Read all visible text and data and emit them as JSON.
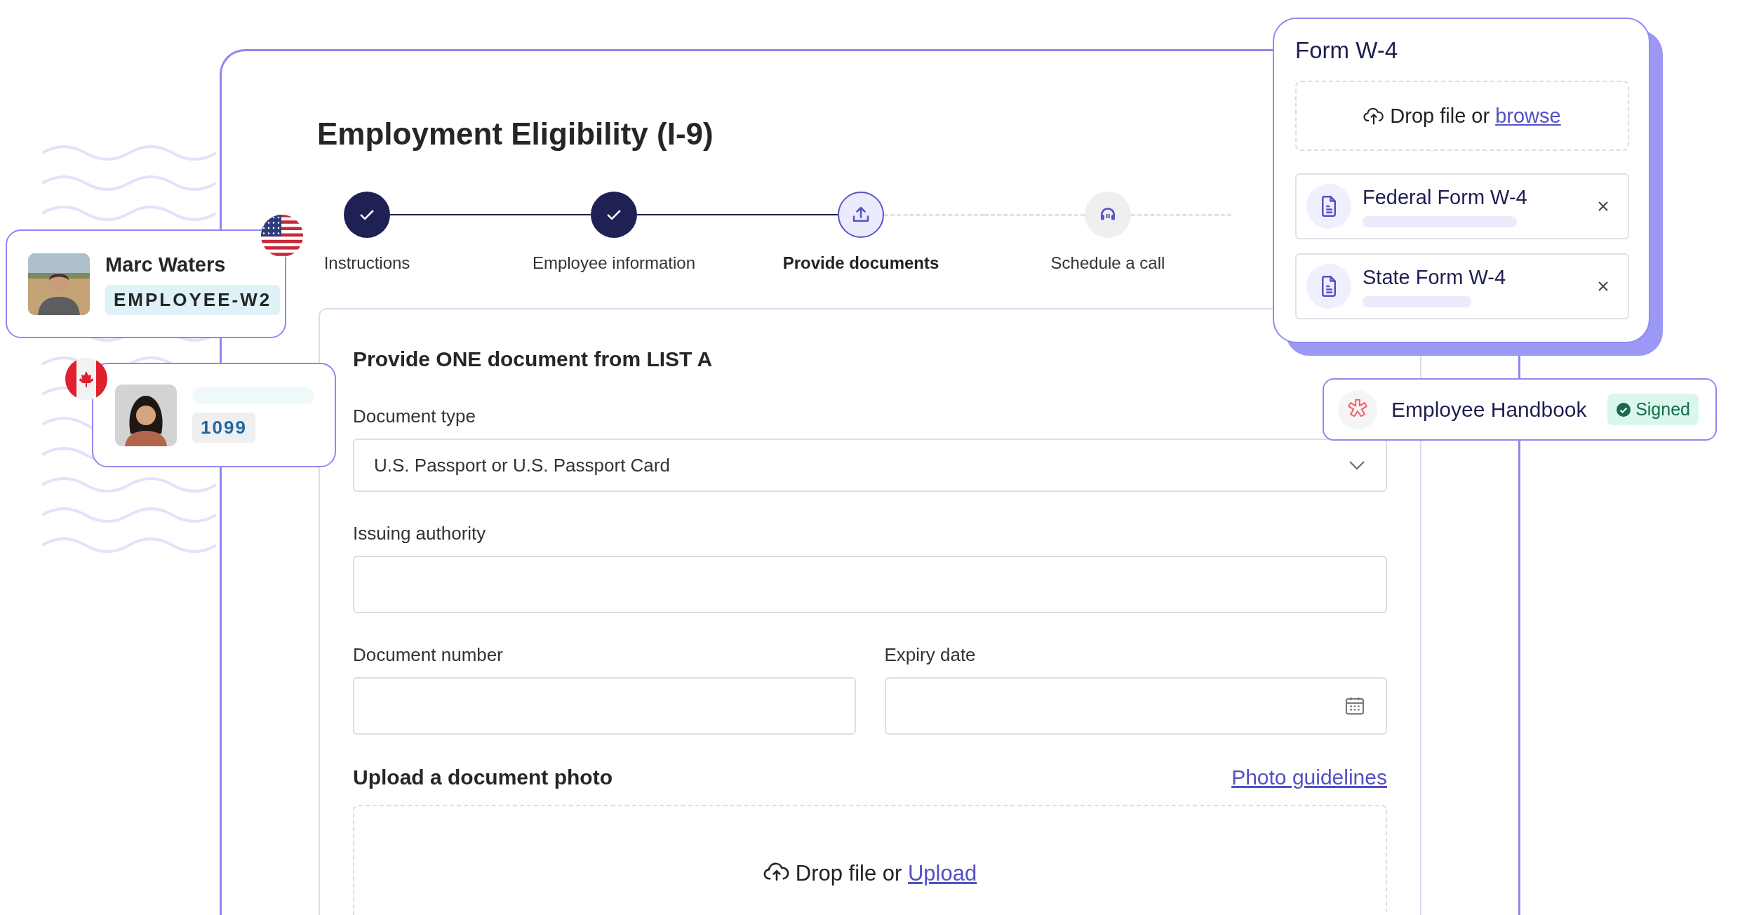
{
  "title": "Employment Eligibility (I-9)",
  "steps": [
    {
      "label": "Instructions",
      "completed": true,
      "selected": false,
      "kind": "check"
    },
    {
      "label": "Employee information",
      "completed": true,
      "selected": false,
      "kind": "check"
    },
    {
      "label": "Provide documents",
      "completed": false,
      "selected": true,
      "kind": "upload"
    },
    {
      "label": "Schedule a call",
      "completed": false,
      "selected": false,
      "kind": "call"
    }
  ],
  "form": {
    "heading": "Provide ONE document from LIST A",
    "rows": [
      [
        {
          "label": "Document type",
          "kind": "select",
          "value": "U.S. Passport or U.S. Passport Card"
        }
      ],
      [
        {
          "label": "Issuing authority",
          "kind": "text"
        }
      ],
      [
        {
          "label": "Document number",
          "kind": "text"
        },
        {
          "label": "Expiry date",
          "kind": "date"
        }
      ]
    ]
  },
  "upload": {
    "heading": "Upload a document photo",
    "link": "Photo guidelines",
    "dropzone": {
      "text": "Drop file or",
      "link": "Upload"
    }
  },
  "people": [
    {
      "name": "Marc Waters",
      "badge": "EMPLOYEE-W2",
      "kind": "us",
      "color": "#dff2f7"
    },
    {
      "badge": "1099",
      "kind": "ca",
      "color": "#eeeff1"
    }
  ],
  "w4": {
    "title": "Form W-4",
    "dropzone": {
      "text": "Drop file or",
      "link": "browse"
    },
    "files": [
      {
        "name": "Federal Form W-4"
      },
      {
        "name": "State Form W-4"
      }
    ]
  },
  "handbook": {
    "title": "Employee Handbook",
    "status": "Signed",
    "signed": true
  }
}
